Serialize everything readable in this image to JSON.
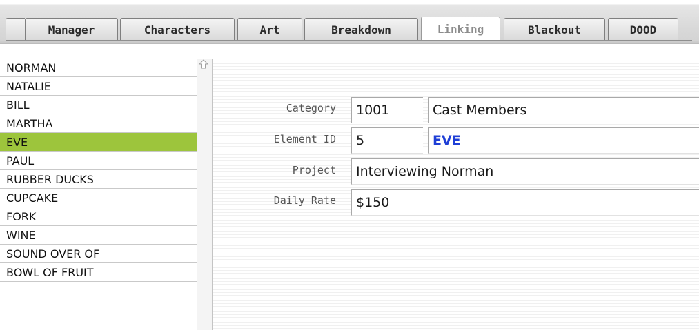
{
  "tabs": [
    {
      "label": "Manager",
      "active": false
    },
    {
      "label": "Characters",
      "active": false
    },
    {
      "label": "Art",
      "active": false
    },
    {
      "label": "Breakdown",
      "active": false
    },
    {
      "label": "Linking",
      "active": true
    },
    {
      "label": "Blackout",
      "active": false
    },
    {
      "label": "DOOD",
      "active": false
    }
  ],
  "elements": [
    {
      "label": "NORMAN"
    },
    {
      "label": "NATALIE"
    },
    {
      "label": "BILL"
    },
    {
      "label": "MARTHA"
    },
    {
      "label": "EVE",
      "selected": true
    },
    {
      "label": "PAUL"
    },
    {
      "label": "RUBBER DUCKS"
    },
    {
      "label": "CUPCAKE"
    },
    {
      "label": "FORK"
    },
    {
      "label": "WINE"
    },
    {
      "label": "SOUND OVER OF"
    },
    {
      "label": "BOWL OF FRUIT"
    }
  ],
  "detail": {
    "category_label": "Category",
    "category_id": "1001",
    "category_name": "Cast Members",
    "element_id_label": "Element ID",
    "element_id": "5",
    "element_name": "EVE",
    "project_label": "Project",
    "project": "Interviewing Norman",
    "daily_rate_label": "Daily Rate",
    "daily_rate": "$150"
  },
  "colors": {
    "selected_row": "#9dc53c",
    "element_name_text": "#1f3fd6"
  },
  "icons": {
    "scroll_up": "scroll-up-arrow-icon"
  }
}
